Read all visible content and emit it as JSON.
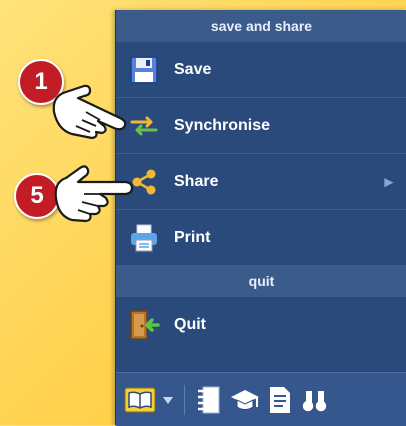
{
  "menu": {
    "sections": [
      {
        "header": "save and share"
      },
      {
        "header": "quit"
      }
    ],
    "items": [
      {
        "label": "Save",
        "icon": "floppy-disk-icon"
      },
      {
        "label": "Synchronise",
        "icon": "sync-arrows-icon"
      },
      {
        "label": "Share",
        "icon": "share-icon",
        "has_submenu": true
      },
      {
        "label": "Print",
        "icon": "printer-icon"
      },
      {
        "label": "Quit",
        "icon": "exit-door-icon"
      }
    ],
    "submenu_arrow": "▶"
  },
  "toolbar": {
    "buttons": [
      {
        "icon": "book-icon"
      },
      {
        "icon": "dropdown-arrow-icon"
      },
      {
        "icon": "notebook-icon"
      },
      {
        "icon": "graduation-cap-icon"
      },
      {
        "icon": "document-icon"
      },
      {
        "icon": "binoculars-icon"
      }
    ]
  },
  "callouts": [
    {
      "number": "1",
      "target": "Synchronise"
    },
    {
      "number": "5",
      "target": "Share"
    }
  ],
  "colors": {
    "background": "#ffd24f",
    "menu": "#2a4a7c",
    "header": "#3b5b8a",
    "badge": "#c21d24"
  }
}
